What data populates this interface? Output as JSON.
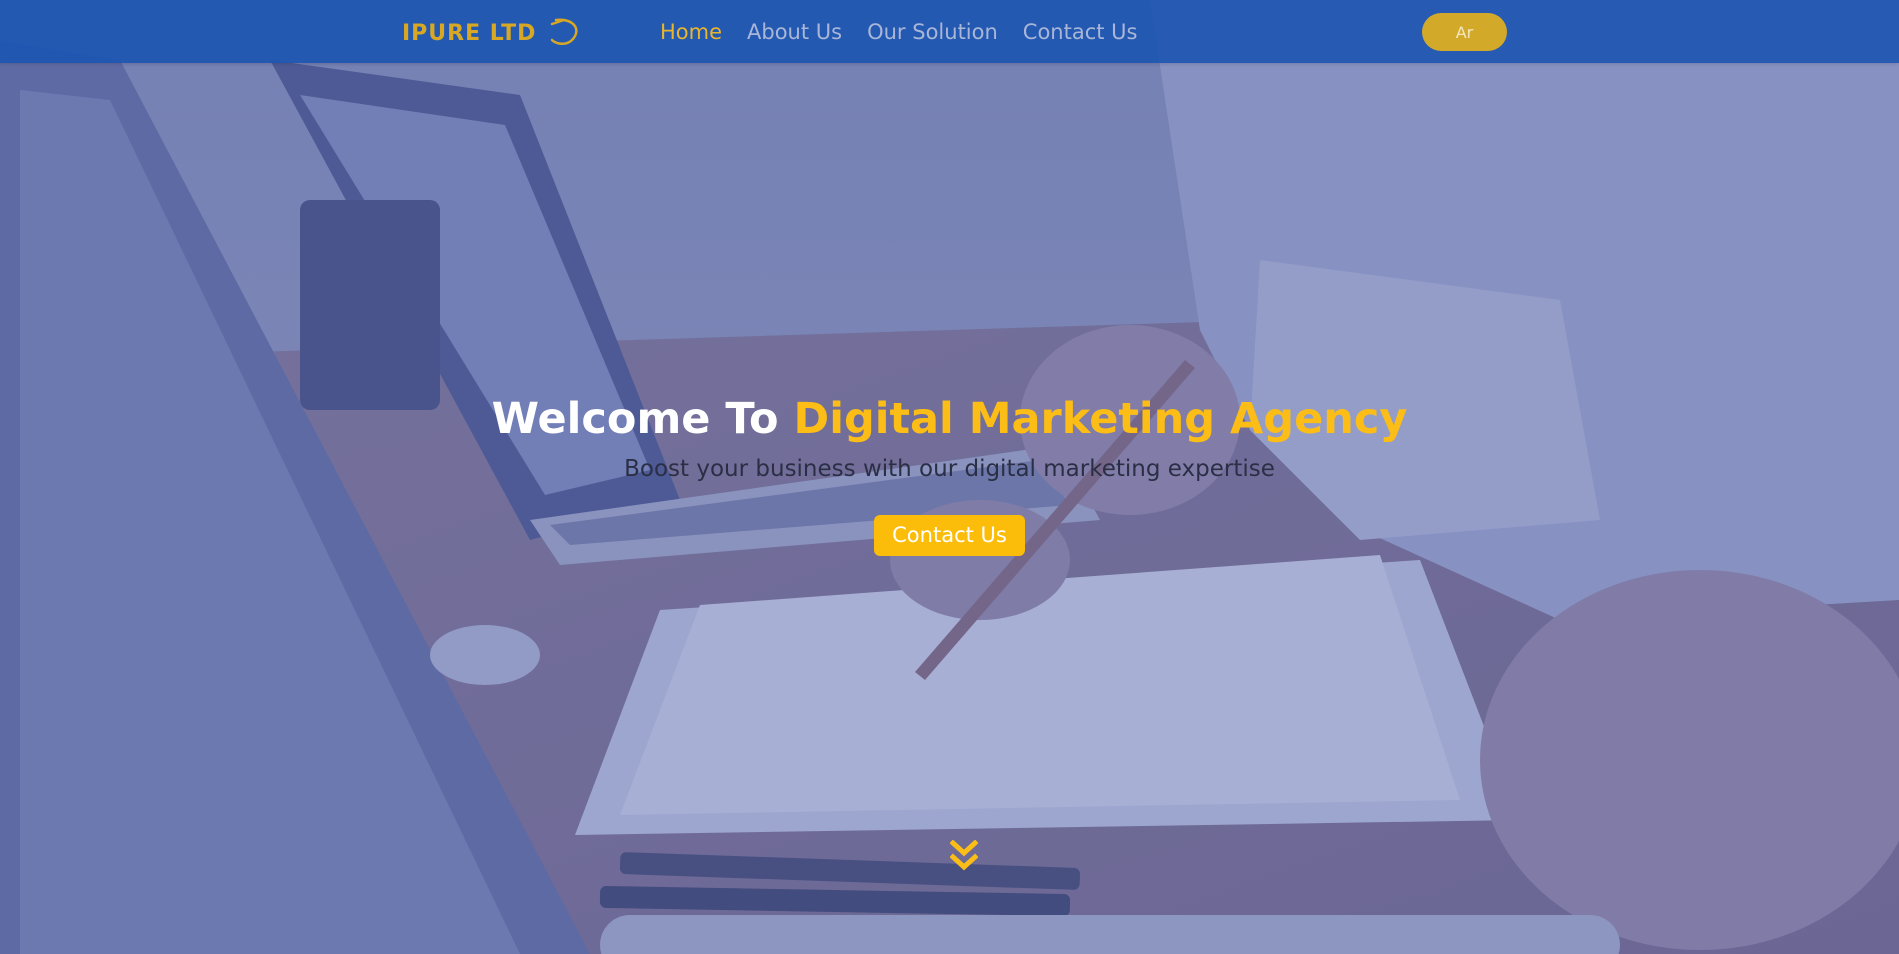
{
  "navbar": {
    "logo": {
      "text": "IPURE LTD",
      "icon": "logo-swoosh-icon"
    },
    "links": [
      {
        "label": "Home",
        "active": true
      },
      {
        "label": "About Us",
        "active": false
      },
      {
        "label": "Our Solution",
        "active": false
      },
      {
        "label": "Contact Us",
        "active": false
      }
    ],
    "language_button": "Ar"
  },
  "hero": {
    "title_prefix": "Welcome To ",
    "title_highlight": "Digital Marketing Agency",
    "subtitle": "Boost your business with our digital marketing expertise",
    "cta_label": "Contact Us",
    "scroll_icon": "double-chevron-down-icon",
    "background": "office desk photo with laptops, papers, pens and hands writing (blue overlay)"
  },
  "colors": {
    "navbar_bg": "#1e56b2",
    "accent_yellow": "#fbbd16",
    "nav_link": "#a9b6d7",
    "nav_link_active": "#e8b52c",
    "overlay": "#4254a8"
  }
}
